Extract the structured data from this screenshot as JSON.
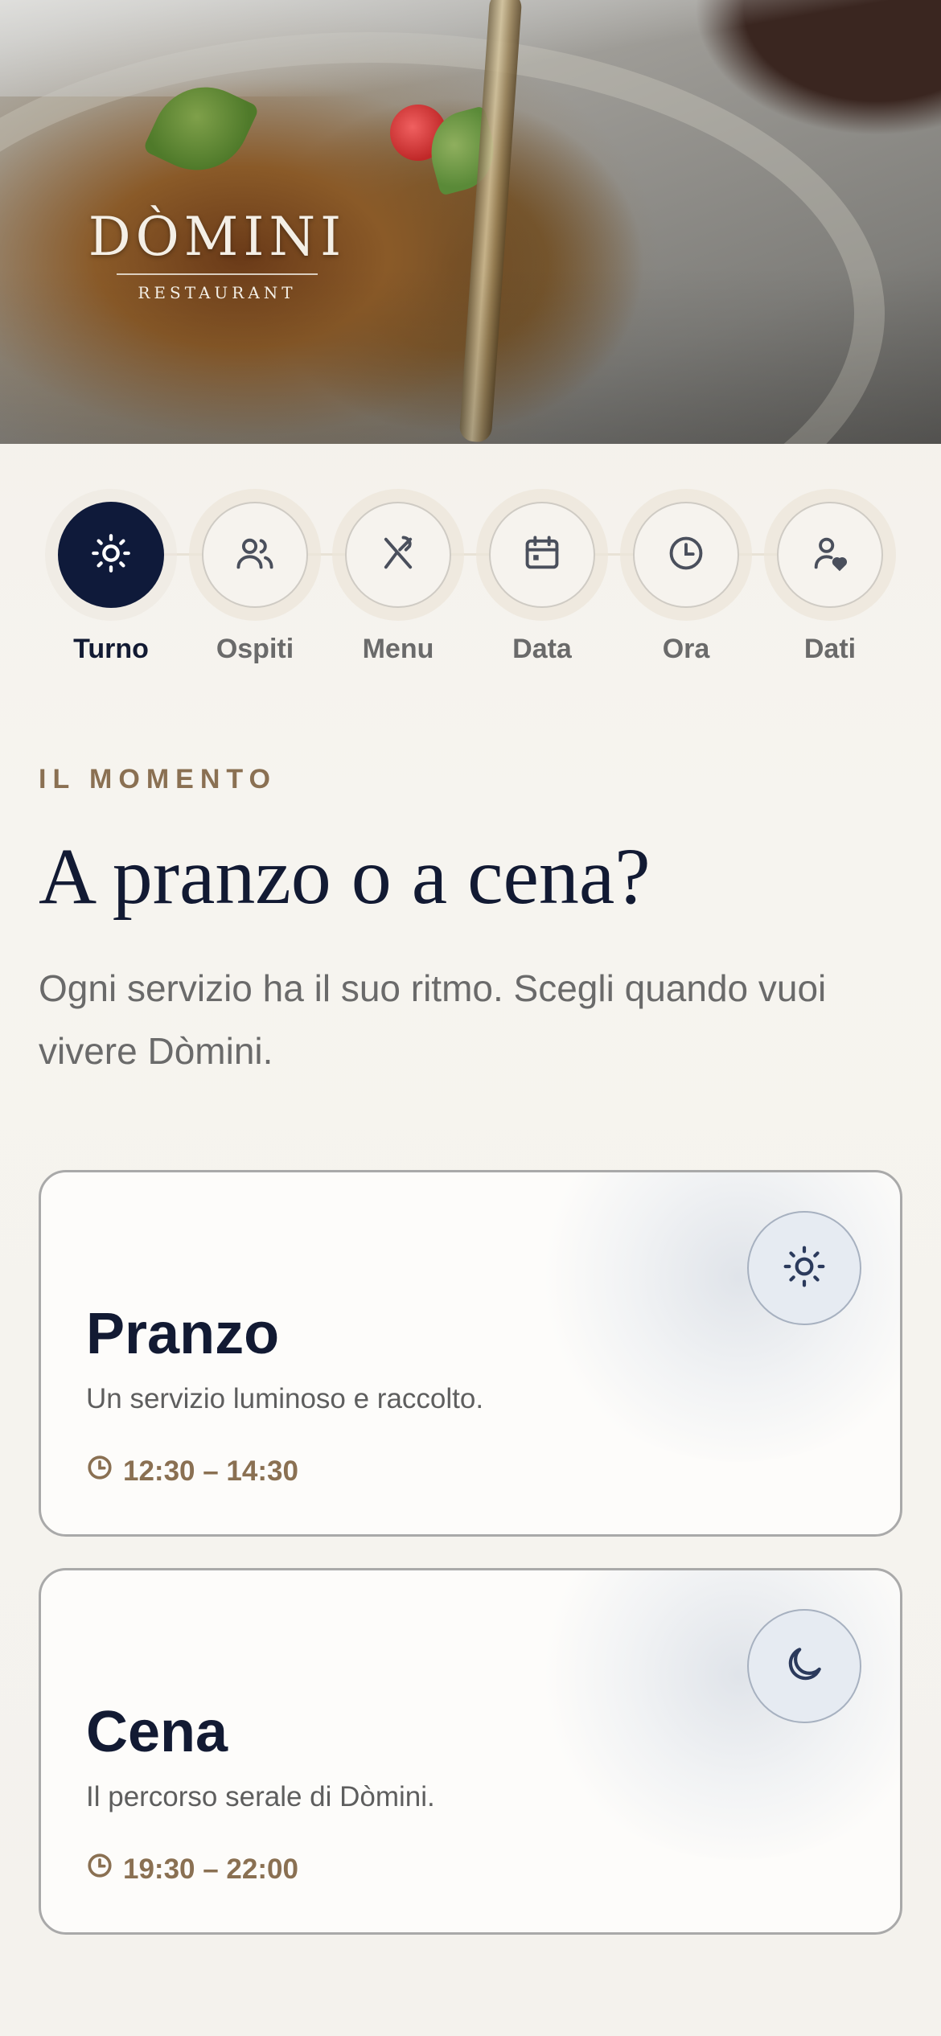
{
  "hero": {
    "logo_name": "DÒMINI",
    "logo_sub": "RESTAURANT"
  },
  "steps": [
    {
      "label": "Turno",
      "icon": "sun-icon",
      "active": true
    },
    {
      "label": "Ospiti",
      "icon": "users-icon",
      "active": false
    },
    {
      "label": "Menu",
      "icon": "utensils-icon",
      "active": false
    },
    {
      "label": "Data",
      "icon": "calendar-icon",
      "active": false
    },
    {
      "label": "Ora",
      "icon": "clock-icon",
      "active": false
    },
    {
      "label": "Dati",
      "icon": "user-heart-icon",
      "active": false
    }
  ],
  "section": {
    "eyebrow": "IL MOMENTO",
    "title": "A pranzo o a cena?",
    "lead": "Ogni servizio ha il suo ritmo. Scegli quando vuoi vivere Dòmini."
  },
  "options": [
    {
      "title": "Pranzo",
      "desc": "Un servizio luminoso e raccolto.",
      "time": "12:30 – 14:30",
      "icon": "sun-icon"
    },
    {
      "title": "Cena",
      "desc": "Il percorso serale di Dòmini.",
      "time": "19:30 – 22:00",
      "icon": "moon-icon"
    }
  ],
  "colors": {
    "navy": "#0f1a3a",
    "gold": "#8a7052",
    "background": "#f4f2ed"
  }
}
